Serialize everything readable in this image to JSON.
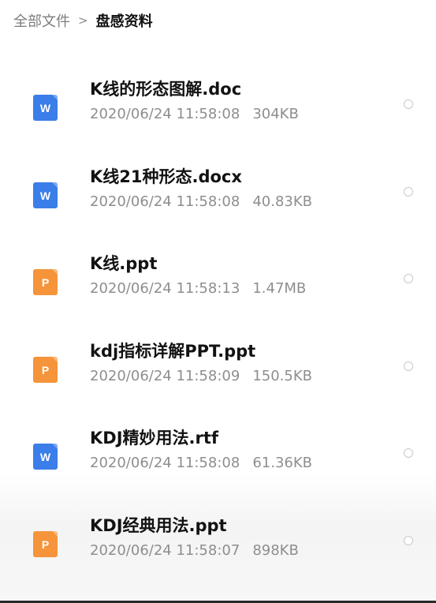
{
  "breadcrumb": {
    "root": "全部文件",
    "separator": ">",
    "current": "盘感资料"
  },
  "files": [
    {
      "name": "K线的形态图解.doc",
      "date": "2020/06/24 11:58:08",
      "size": "304KB",
      "icon": "word-doc-icon",
      "badge": "W"
    },
    {
      "name": "K线21种形态.docx",
      "date": "2020/06/24 11:58:08",
      "size": "40.83KB",
      "icon": "word-doc-icon",
      "badge": "W"
    },
    {
      "name": "K线.ppt",
      "date": "2020/06/24 11:58:13",
      "size": "1.47MB",
      "icon": "ppt-doc-icon",
      "badge": "P"
    },
    {
      "name": "kdj指标详解PPT.ppt",
      "date": "2020/06/24 11:58:09",
      "size": "150.5KB",
      "icon": "ppt-doc-icon",
      "badge": "P"
    },
    {
      "name": "KDJ精妙用法.rtf",
      "date": "2020/06/24 11:58:08",
      "size": "61.36KB",
      "icon": "word-doc-icon",
      "badge": "W"
    },
    {
      "name": "KDJ经典用法.ppt",
      "date": "2020/06/24 11:58:07",
      "size": "898KB",
      "icon": "ppt-doc-icon",
      "badge": "P"
    }
  ],
  "colors": {
    "word": "#3b7de9",
    "ppt": "#f5943a",
    "text_primary": "#121212",
    "text_secondary": "#8e8e8e"
  }
}
